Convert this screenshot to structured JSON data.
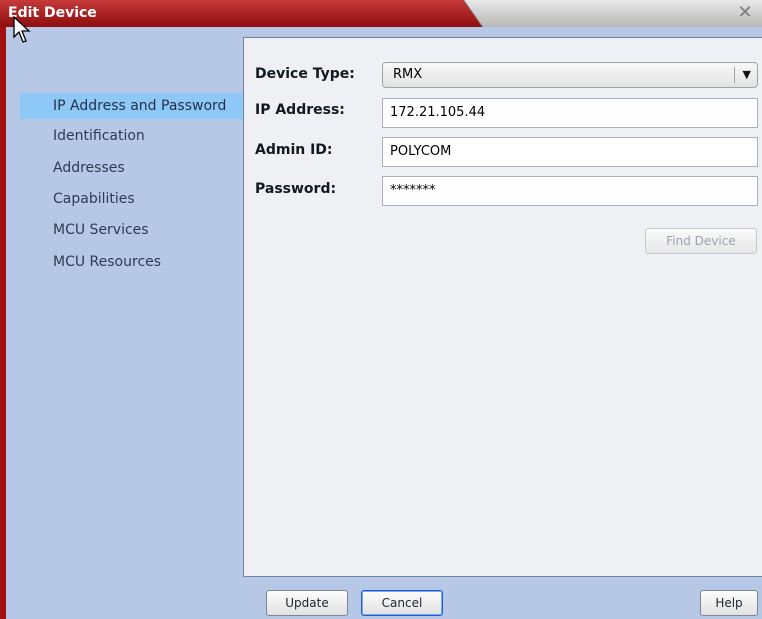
{
  "window": {
    "title": "Edit Device",
    "close_glyph": "✕"
  },
  "sidebar": {
    "items": [
      {
        "label": "IP Address and Password",
        "selected": true
      },
      {
        "label": "Identification",
        "selected": false
      },
      {
        "label": "Addresses",
        "selected": false
      },
      {
        "label": "Capabilities",
        "selected": false
      },
      {
        "label": "MCU Services",
        "selected": false
      },
      {
        "label": "MCU Resources",
        "selected": false
      }
    ]
  },
  "form": {
    "device_type_label": "Device Type:",
    "device_type_value": "RMX",
    "dropdown_glyph": "▼",
    "ip_label": "IP Address:",
    "ip_value": "172.21.105.44",
    "admin_label": "Admin ID:",
    "admin_value": "POLYCOM",
    "password_label": "Password:",
    "password_value": "*******",
    "find_device_label": "Find Device"
  },
  "footer": {
    "update_label": "Update",
    "cancel_label": "Cancel",
    "help_label": "Help"
  },
  "colors": {
    "title_bar": "#a01010",
    "sidebar_bg": "#b7c8e6",
    "selected_item": "#8ec8f6",
    "panel_bg": "#eef0f3"
  }
}
